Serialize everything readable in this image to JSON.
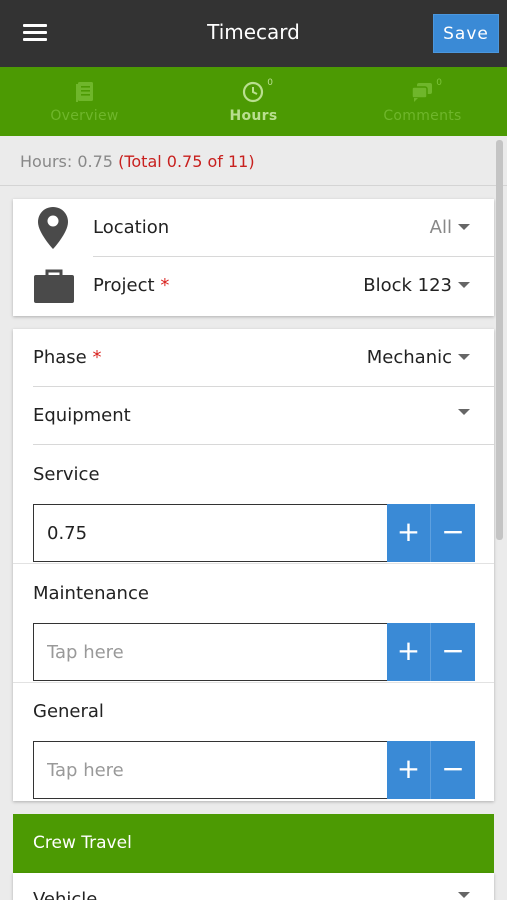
{
  "header": {
    "title": "Timecard",
    "save_label": "Save",
    "menu_icon": "hamburger-menu-icon"
  },
  "tabs": [
    {
      "label": "Overview",
      "icon": "document-icon",
      "active": false
    },
    {
      "label": "Hours",
      "icon": "clock-icon",
      "badge": "0",
      "active": true
    },
    {
      "label": "Comments",
      "icon": "chat-bubbles-icon",
      "badge": "0",
      "active": false
    }
  ],
  "hours_summary": {
    "text": "Hours: 0.75",
    "total_text": "(Total 0.75 of 11)"
  },
  "location": {
    "label": "Location",
    "value": "All",
    "icon": "map-pin-icon"
  },
  "project": {
    "label": "Project",
    "required_mark": "*",
    "value": "Block 123",
    "icon": "briefcase-icon"
  },
  "phase": {
    "label": "Phase",
    "required_mark": "*",
    "value": "Mechanic"
  },
  "equipment": {
    "label": "Equipment",
    "value": ""
  },
  "hour_fields": [
    {
      "label": "Service",
      "value": "0.75",
      "placeholder": "Tap here"
    },
    {
      "label": "Maintenance",
      "value": "",
      "placeholder": "Tap here"
    },
    {
      "label": "General",
      "value": "",
      "placeholder": "Tap here"
    }
  ],
  "stepper": {
    "plus": "+",
    "minus": "−"
  },
  "crew_travel": {
    "title": "Crew Travel",
    "vehicle_label": "Vehicle"
  },
  "colors": {
    "header": "#333333",
    "accent_green": "#4c9a03",
    "button_blue": "#3a8ad6",
    "required_red": "#d9231f",
    "total_red": "#c8201e"
  }
}
